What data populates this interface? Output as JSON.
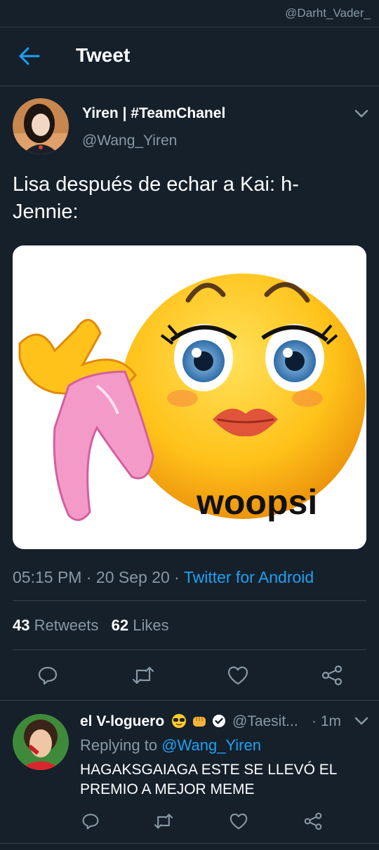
{
  "watermark": "@Darht_Vader_",
  "header": {
    "title": "Tweet"
  },
  "tweet": {
    "author_name": "Yiren | #TeamChanel",
    "author_handle": "@Wang_Yiren",
    "text": "Lisa después de echar a Kai: h-\nJennie:",
    "image_caption": "woopsi",
    "time": "05:15 PM",
    "date": "20 Sep 20",
    "source": "Twitter for Android",
    "retweets_count": "43",
    "retweets_label": "Retweets",
    "likes_count": "62",
    "likes_label": "Likes"
  },
  "reply": {
    "author_name": "el V-loguero",
    "author_handle": "@Taesit...",
    "time": "1m",
    "replying_prefix": "Replying to",
    "replying_to": "@Wang_Yiren",
    "text": "HAGAKSGAIAGA ESTE SE LLEVÓ EL PREMIO A MEJOR MEME"
  },
  "icons": [
    "back-arrow-icon",
    "chevron-down-icon",
    "reply-icon",
    "retweet-icon",
    "like-icon",
    "share-icon",
    "sunglasses-emoji-icon",
    "fist-emoji-icon",
    "verified-badge-icon"
  ],
  "colors": {
    "background": "#15202b",
    "accent": "#1da1f2",
    "secondary_text": "#8899a6",
    "divider": "#38444d"
  }
}
